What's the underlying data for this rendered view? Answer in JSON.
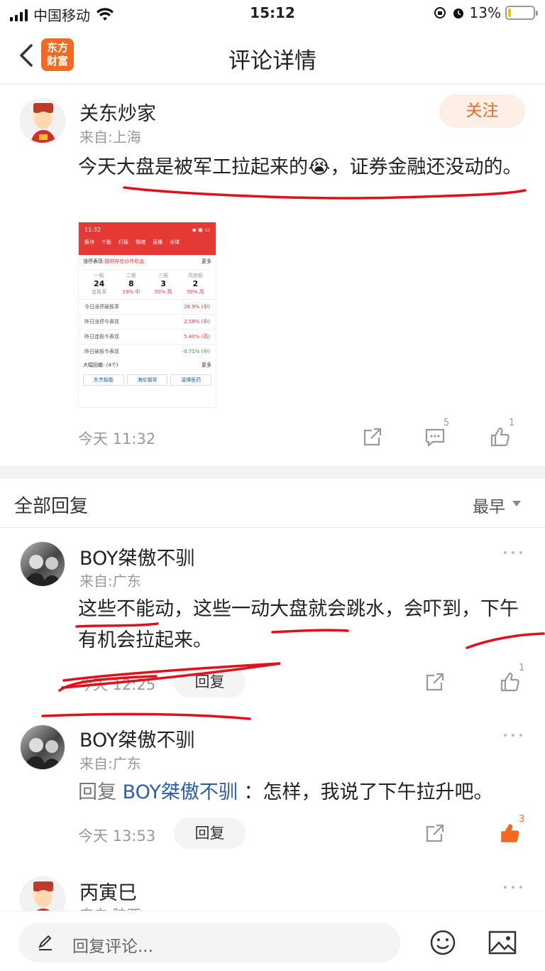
{
  "status_bar": {
    "carrier": "中国移动",
    "time": "15:12",
    "battery": "13%",
    "battery_level": 0.13
  },
  "header": {
    "logo_text_top": "东方",
    "logo_text_bottom": "财富",
    "title": "评论详情"
  },
  "post": {
    "author": "关东炒家",
    "location": "来自:上海",
    "follow_label": "关注",
    "text": "今天大盘是被军工拉起来的😭，证券金融还没动的。",
    "time": "今天 11:32",
    "comment_count": "5",
    "like_count": "1",
    "preview": {
      "time": "11:32",
      "tabs": [
        "板块",
        "个股",
        "打板",
        "情绪",
        "直播",
        "全球"
      ],
      "section1": "涨停表现:",
      "section1_tag": "题材存在炒作机会",
      "more": "更多",
      "grid_labels": [
        "一板",
        "二板",
        "三板",
        "高度板"
      ],
      "grid_values": [
        "24",
        "8",
        "3",
        "2"
      ],
      "grid_subs": [
        "连板率",
        "19% 中",
        "50% 高",
        "50% 高"
      ],
      "rows": [
        {
          "label": "今日涨停破板率",
          "value": "28.9% (中)"
        },
        {
          "label": "昨日涨停今表现",
          "value": "2.58% (中)"
        },
        {
          "label": "昨日连板今表现",
          "value": "5.40% (高)"
        },
        {
          "label": "昨日破板今表现",
          "value": "-0.71% (中)"
        }
      ],
      "section2": "大幅回撤: (4个)",
      "stocks": [
        "东杰智能",
        "海伦钢琴",
        "温博医药"
      ]
    }
  },
  "replies_header": {
    "title": "全部回复",
    "sort": "最早"
  },
  "replies": [
    {
      "author": "BOY桀傲不驯",
      "location": "来自:广东",
      "text": "这些不能动，这些一动大盘就会跳水，会吓到，下午有机会拉起来。",
      "time": "今天 12:25",
      "reply_label": "回复",
      "like_count": "1"
    },
    {
      "author": "BOY桀傲不驯",
      "location": "来自:广东",
      "reply_prefix": "回复",
      "reply_to": "BOY桀傲不驯",
      "reply_sep": "：",
      "text": "怎样，我说了下午拉升吧。",
      "time": "今天 13:53",
      "reply_label": "回复",
      "like_count": "3"
    },
    {
      "author": "丙寅巳",
      "location": "来自:陕西"
    }
  ],
  "bottom": {
    "input_placeholder": "回复评论..."
  },
  "colors": {
    "brand": "#f06a22",
    "like_active": "#f06a22",
    "link": "#2a5db0",
    "annotation": "#e3101a"
  }
}
